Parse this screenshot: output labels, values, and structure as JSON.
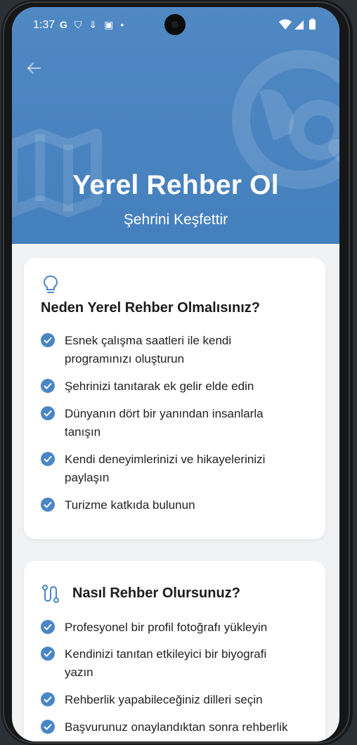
{
  "status_bar": {
    "time": "1:37",
    "icons": [
      "google-icon",
      "shield-icon",
      "download-icon",
      "app-icon",
      "dot-icon",
      "wifi-icon",
      "signal-icon",
      "battery-icon"
    ]
  },
  "header": {
    "title": "Yerel Rehber Ol",
    "subtitle": "Şehrini Keşfettir"
  },
  "why_card": {
    "title": "Neden Yerel Rehber Olmalısınız?",
    "items": [
      {
        "line1": "Esnek çalışma saatleri ile kendi",
        "line2": "programınızı oluşturun"
      },
      {
        "line1": "Şehrinizi tanıtarak ek gelir elde edin",
        "line2": ""
      },
      {
        "line1": "Dünyanın dört bir yanından insanlarla",
        "line2": "tanışın"
      },
      {
        "line1": "Kendi deneyimlerinizi ve hikayelerinizi",
        "line2": "paylaşın"
      },
      {
        "line1": "Turizme katkıda bulunun",
        "line2": ""
      }
    ]
  },
  "how_card": {
    "title": "Nasıl Rehber Olursunuz?",
    "items": [
      {
        "line1": "Profesyonel bir profil fotoğrafı yükleyin",
        "line2": ""
      },
      {
        "line1": "Kendinizi tanıtan etkileyici bir biyografi",
        "line2": "yazın"
      },
      {
        "line1": "Rehberlik yapabileceğiniz dilleri seçin",
        "line2": ""
      },
      {
        "line1": "Başvurunuz onaylandıktan sonra rehberlik",
        "line2": ""
      }
    ]
  },
  "colors": {
    "accent": "#4a84c0",
    "check": "#4a86c5",
    "card": "#ffffff",
    "background": "#f1f2f4"
  }
}
